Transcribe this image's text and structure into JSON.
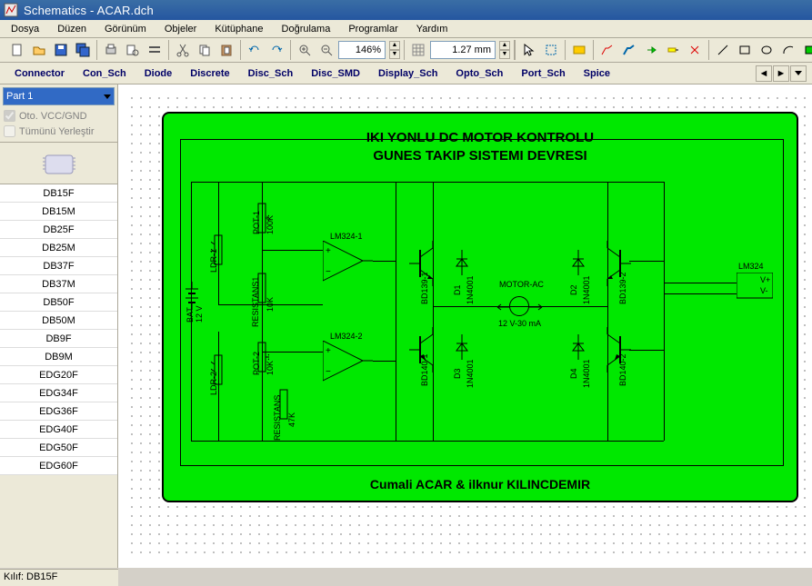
{
  "title": "Schematics - ACAR.dch",
  "menu": [
    "Dosya",
    "Düzen",
    "Görünüm",
    "Objeler",
    "Kütüphane",
    "Doğrulama",
    "Programlar",
    "Yardım"
  ],
  "zoom": "146%",
  "grid": "1.27 mm",
  "libs": [
    "Connector",
    "Con_Sch",
    "Diode",
    "Discrete",
    "Disc_Sch",
    "Disc_SMD",
    "Display_Sch",
    "Opto_Sch",
    "Port_Sch",
    "Spice"
  ],
  "partsel": "Part 1",
  "chk1": "Oto. VCC/GND",
  "chk2": "Tümünü Yerleştir",
  "parts": [
    "DB15F",
    "DB15M",
    "DB25F",
    "DB25M",
    "DB37F",
    "DB37M",
    "DB50F",
    "DB50M",
    "DB9F",
    "DB9M",
    "EDG20F",
    "EDG34F",
    "EDG36F",
    "EDG40F",
    "EDG50F",
    "EDG60F"
  ],
  "status_left": "Kılıf: DB15F",
  "sch": {
    "title1": "IKI YONLU DC MOTOR KONTROLU",
    "title2": "GUNES TAKIP SISTEMI DEVRESI",
    "author": "Cumali ACAR & ilknur KILINCDEMIR",
    "labels": [
      "BAT",
      "12 V",
      "LDR-1",
      "LDR-2",
      "POT-1",
      "100K",
      "POT-2",
      "10K",
      "RESISTANS1",
      "10K",
      "RESISTANS",
      "47K",
      "LM324-1",
      "LM324-2",
      "BD139-1",
      "BD140-1",
      "BD139-2",
      "BD140-2",
      "D1",
      "1N4001",
      "D2",
      "1N4001",
      "D3",
      "1N4001",
      "D4",
      "1N4001",
      "MOTOR-AC",
      "12 V-30 mA",
      "LM324",
      "V+",
      "V-"
    ]
  }
}
